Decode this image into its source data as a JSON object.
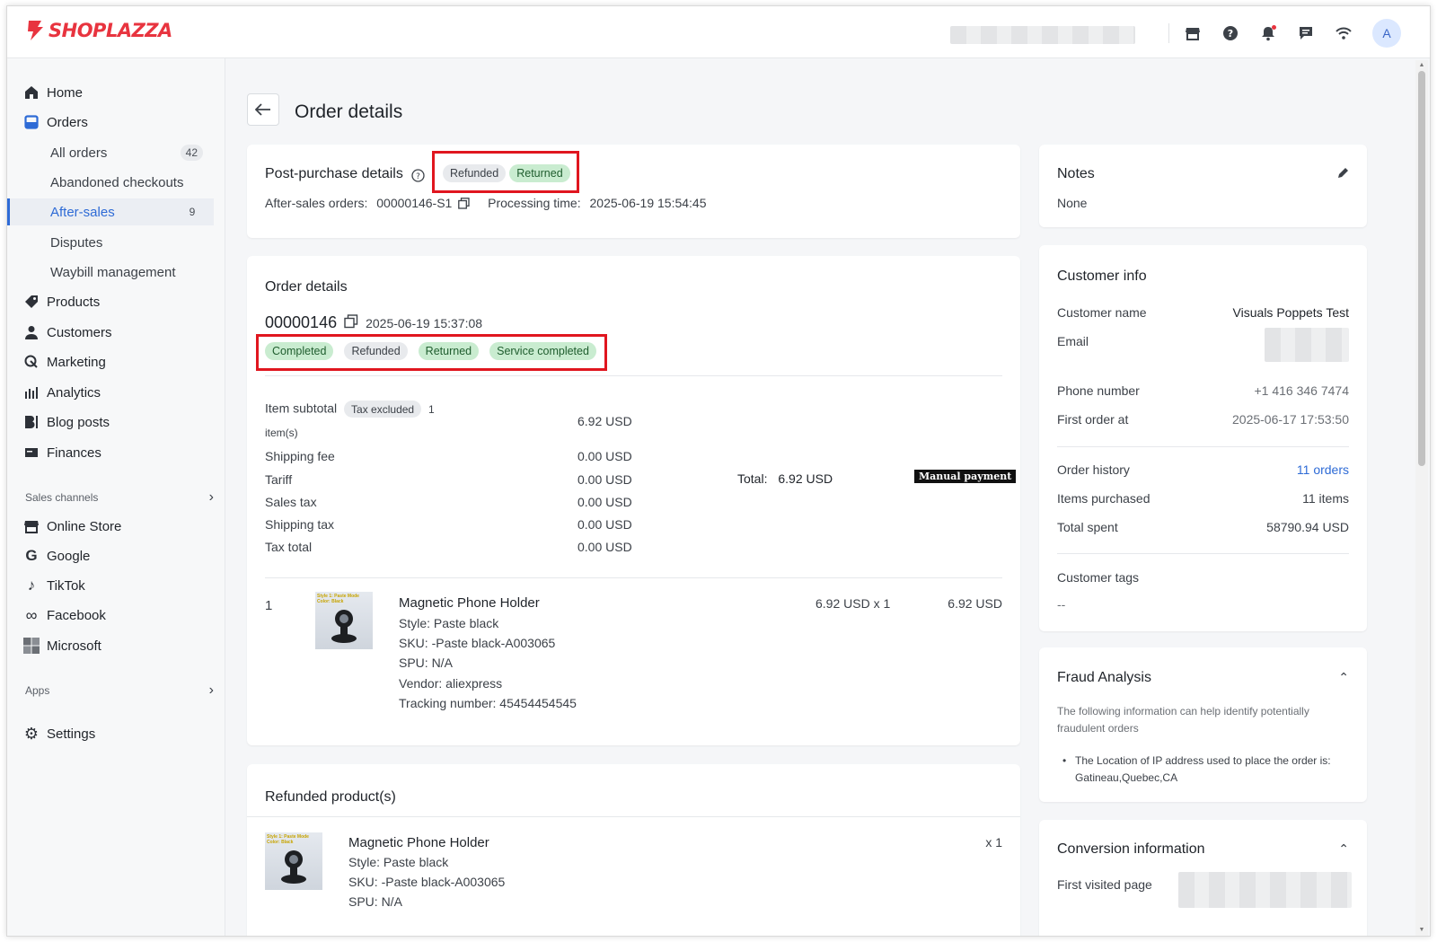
{
  "brand": {
    "name": "SHOPLAZZA",
    "color": "#e8343f"
  },
  "topbar": {
    "icons": [
      "store-icon",
      "help-icon",
      "bell-icon",
      "message-icon",
      "wifi-icon"
    ],
    "avatar_initial": "A"
  },
  "sidebar": {
    "items": [
      {
        "label": "Home",
        "icon": "home-icon"
      },
      {
        "label": "Orders",
        "icon": "orders-icon"
      },
      {
        "label": "All orders",
        "count": "42"
      },
      {
        "label": "Abandoned checkouts"
      },
      {
        "label": "After-sales",
        "count": "9"
      },
      {
        "label": "Disputes"
      },
      {
        "label": "Waybill management"
      },
      {
        "label": "Products",
        "icon": "tag-icon"
      },
      {
        "label": "Customers",
        "icon": "person-icon"
      },
      {
        "label": "Marketing",
        "icon": "marketing-icon"
      },
      {
        "label": "Analytics",
        "icon": "analytics-icon"
      },
      {
        "label": "Blog posts",
        "icon": "blog-icon"
      },
      {
        "label": "Finances",
        "icon": "finances-icon"
      }
    ],
    "sales_channels_label": "Sales channels",
    "channels": [
      {
        "label": "Online Store",
        "icon": "store-icon"
      },
      {
        "label": "Google",
        "icon": "google-icon"
      },
      {
        "label": "TikTok",
        "icon": "tiktok-icon"
      },
      {
        "label": "Facebook",
        "icon": "meta-icon"
      },
      {
        "label": "Microsoft",
        "icon": "microsoft-icon"
      }
    ],
    "apps_label": "Apps",
    "settings_label": "Settings"
  },
  "page": {
    "title": "Order details"
  },
  "post_purchase": {
    "title": "Post-purchase details",
    "tags": [
      "Refunded",
      "Returned"
    ],
    "after_sales_label": "After-sales orders:",
    "after_sales_value": "00000146-S1",
    "processing_label": "Processing time:",
    "processing_value": "2025-06-19 15:54:45"
  },
  "order": {
    "title": "Order details",
    "number": "00000146",
    "date": "2025-06-19 15:37:08",
    "tags": [
      "Completed",
      "Refunded",
      "Returned",
      "Service completed"
    ],
    "item_subtotal_label": "Item subtotal",
    "tax_excluded": "Tax excluded",
    "item_count": "1",
    "items_unit": "item(s)",
    "item_subtotal_value": "6.92 USD",
    "rows": [
      {
        "label": "Shipping fee",
        "value": "0.00 USD"
      },
      {
        "label": "Tariff",
        "value": "0.00 USD"
      },
      {
        "label": "Sales tax",
        "value": "0.00 USD"
      },
      {
        "label": "Shipping tax",
        "value": "0.00 USD"
      },
      {
        "label": "Tax total",
        "value": "0.00 USD"
      }
    ],
    "total_label": "Total:",
    "total_value": "6.92 USD",
    "payment_badge": "Manual payment",
    "line_item": {
      "index": "1",
      "name": "Magnetic Phone Holder",
      "style": "Style: Paste black",
      "sku": "SKU: -Paste black-A003065",
      "spu": "SPU: N/A",
      "vendor": "Vendor: aliexpress",
      "tracking": "Tracking number: 45454454545",
      "unit_price": "6.92 USD x 1",
      "line_total": "6.92 USD",
      "thumb_text": "Style 1: Paste Mode Color: Black"
    }
  },
  "refunded": {
    "title": "Refunded product(s)",
    "name": "Magnetic Phone Holder",
    "style": "Style: Paste black",
    "sku": "SKU: -Paste black-A003065",
    "spu": "SPU: N/A",
    "qty": "x 1",
    "thumb_text": "Style 1: Paste Mode Color: Black"
  },
  "notes": {
    "title": "Notes",
    "value": "None"
  },
  "customer": {
    "title": "Customer info",
    "name_label": "Customer name",
    "name_value": "Visuals Poppets Test",
    "email_label": "Email",
    "phone_label": "Phone number",
    "phone_value": "+1 416 346 7474",
    "first_order_label": "First order at",
    "first_order_value": "2025-06-17 17:53:50",
    "history_label": "Order history",
    "history_value": "11 orders",
    "items_label": "Items purchased",
    "items_value": "11 items",
    "spent_label": "Total spent",
    "spent_value": "58790.94 USD",
    "tags_label": "Customer tags",
    "tags_value": "--"
  },
  "fraud": {
    "title": "Fraud Analysis",
    "desc": "The following information can help identify potentially fraudulent orders",
    "bullet": "The Location of IP address used to place the order is: Gatineau,Quebec,CA"
  },
  "conversion": {
    "title": "Conversion information",
    "first_page_label": "First visited page"
  },
  "colors": {
    "accent": "#2e6bd6",
    "highlight": "#e0161f",
    "tag_green": "#c9ecd0",
    "tag_grey": "#e8eaed"
  }
}
